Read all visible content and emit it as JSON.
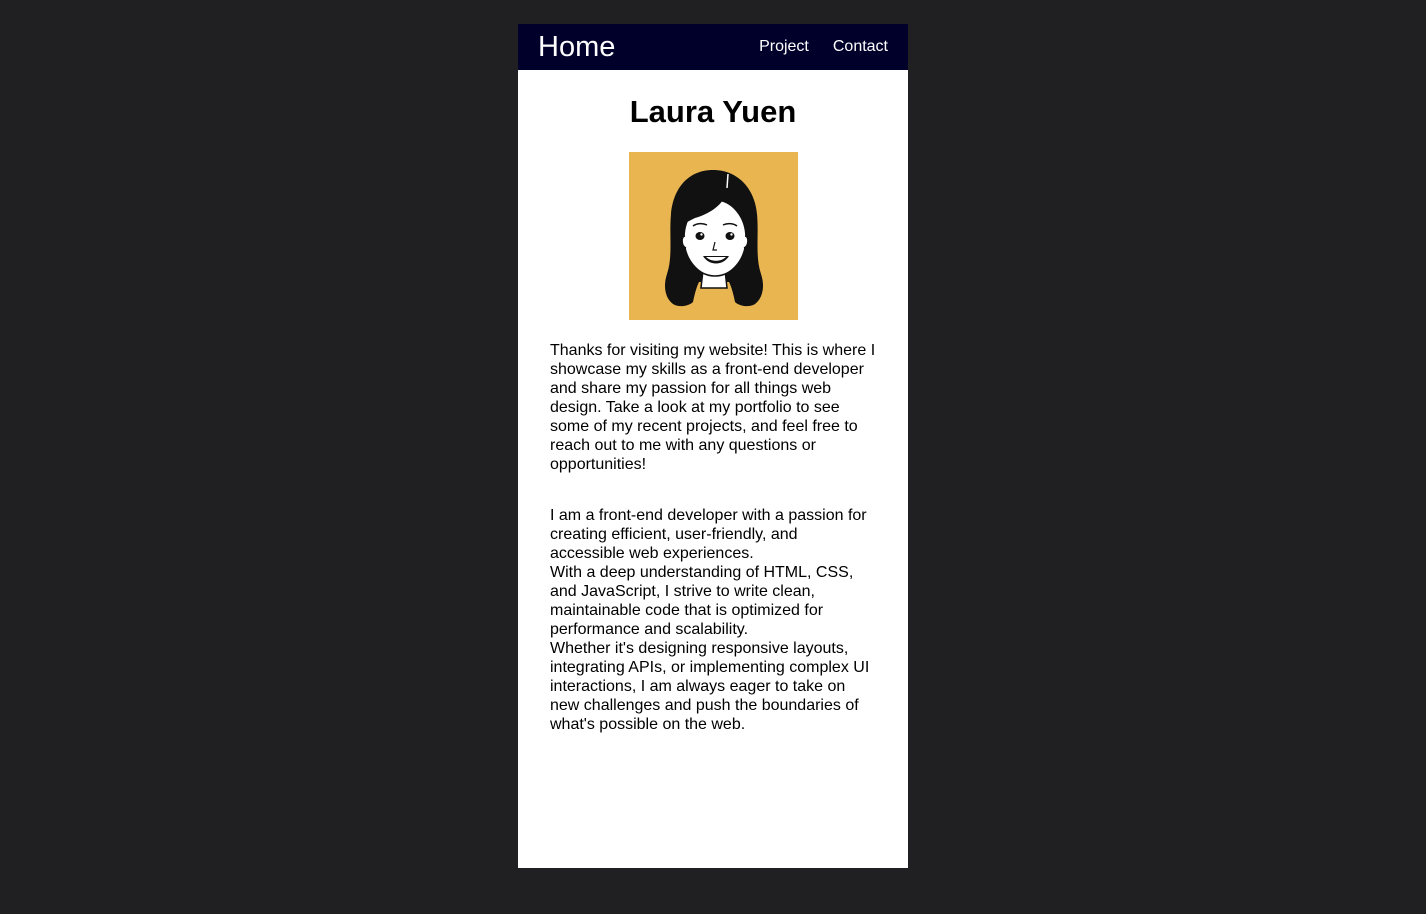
{
  "nav": {
    "brand": "Home",
    "links": [
      "Project",
      "Contact"
    ]
  },
  "profile": {
    "name": "Laura Yuen",
    "avatar_icon": "cartoon-portrait-avatar",
    "avatar_bg": "#e8b551"
  },
  "intro": "Thanks for visiting my website! This is where I showcase my skills as a front-end developer and share my passion for all things web design. Take a look at my portfolio to see some of my recent projects, and feel free to reach out to me with any questions or opportunities!",
  "about": [
    "I am a front-end developer with a passion for creating efficient, user-friendly, and accessible web experiences.",
    "With a deep understanding of HTML, CSS, and JavaScript, I strive to write clean, maintainable code that is optimized for performance and scalability.",
    "Whether it's designing responsive layouts, integrating APIs, or implementing complex UI interactions, I am always eager to take on new challenges and push the boundaries of what's possible on the web."
  ],
  "colors": {
    "page_bg": "#202022",
    "nav_bg": "#00002a",
    "card_bg": "#ffffff"
  }
}
